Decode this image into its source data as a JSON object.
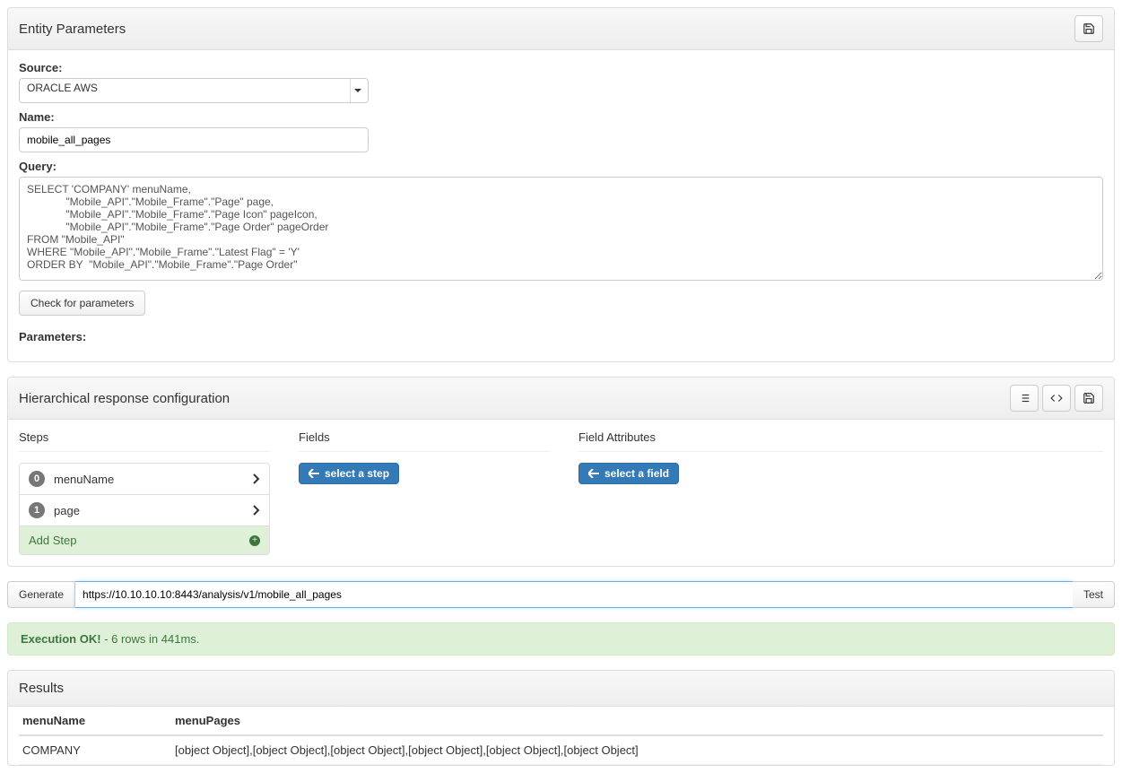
{
  "panel1": {
    "title": "Entity Parameters",
    "source_label": "Source:",
    "source_value": "ORACLE AWS",
    "name_label": "Name:",
    "name_value": "mobile_all_pages",
    "query_label": "Query:",
    "query_value": "SELECT 'COMPANY' menuName,\n             \"Mobile_API\".\"Mobile_Frame\".\"Page\" page,\n             \"Mobile_API\".\"Mobile_Frame\".\"Page Icon\" pageIcon,\n             \"Mobile_API\".\"Mobile_Frame\".\"Page Order\" pageOrder\nFROM \"Mobile_API\"\nWHERE \"Mobile_API\".\"Mobile_Frame\".\"Latest Flag\" = 'Y'\nORDER BY  \"Mobile_API\".\"Mobile_Frame\".\"Page Order\"",
    "check_params_label": "Check for parameters",
    "parameters_label": "Parameters:"
  },
  "panel2": {
    "title": "Hierarchical response configuration",
    "steps_header": "Steps",
    "fields_header": "Fields",
    "attrs_header": "Field Attributes",
    "steps": [
      {
        "index": "0",
        "name": "menuName"
      },
      {
        "index": "1",
        "name": "page"
      }
    ],
    "add_step_label": "Add Step",
    "select_step_label": "select a step",
    "select_field_label": "select a field"
  },
  "urlbar": {
    "generate_label": "Generate",
    "url_value": "https://10.10.10.10:8443/analysis/v1/mobile_all_pages",
    "test_label": "Test"
  },
  "execution": {
    "status_bold": "Execution OK!",
    "status_rest": " - 6 rows in 441ms."
  },
  "results_panel": {
    "title": "Results",
    "headers": [
      "menuName",
      "menuPages"
    ],
    "rows": [
      [
        "COMPANY",
        "[object Object],[object Object],[object Object],[object Object],[object Object],[object Object]"
      ]
    ]
  }
}
